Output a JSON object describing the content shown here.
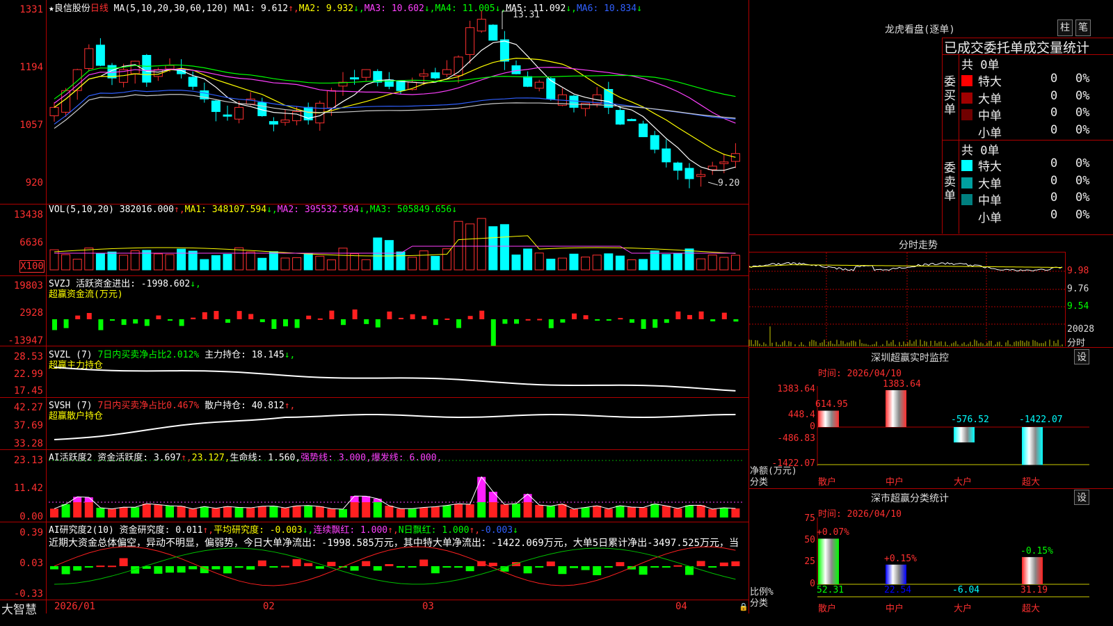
{
  "left_axis": {
    "price": [
      "1331",
      "1194",
      "1057",
      "920"
    ],
    "vol": [
      "13438",
      "6636",
      "X100"
    ],
    "svzj": [
      "19803",
      "2928",
      "-13947"
    ],
    "svzl": [
      "28.53",
      "22.99",
      "17.45"
    ],
    "svsh": [
      "42.27",
      "37.69",
      "33.28"
    ],
    "ai2": [
      "23.13",
      "11.42",
      "0.00"
    ],
    "aiyj": [
      "0.39",
      "0.03",
      "-0.33"
    ]
  },
  "main_header": [
    {
      "t": "★良信股份",
      "c": "#ffffff"
    },
    {
      "t": "日线",
      "c": "#ff3030"
    },
    {
      "t": " MA(5,10,20,30,60,120) MA1: 9.612",
      "c": "#ffffff"
    },
    {
      "t": "↑,",
      "c": "#ff3030"
    },
    {
      "t": "MA2: 9.932",
      "c": "#ffff00"
    },
    {
      "t": "↓,",
      "c": "#00ff00"
    },
    {
      "t": "MA3: 10.602",
      "c": "#ff40ff"
    },
    {
      "t": "↓,",
      "c": "#00ff00"
    },
    {
      "t": "MA4: 11.005",
      "c": "#00ff00"
    },
    {
      "t": "↓,",
      "c": "#00ff00"
    },
    {
      "t": "MA5: 11.092",
      "c": "#ffffff"
    },
    {
      "t": "↓,",
      "c": "#00ff00"
    },
    {
      "t": "MA6: 10.834",
      "c": "#3060ff"
    },
    {
      "t": "↓",
      "c": "#00ff00"
    }
  ],
  "price_marks": {
    "high": "13.31",
    "low": "9.20"
  },
  "vol_header": [
    {
      "t": "VOL(5,10,20) 382016.000",
      "c": "#ffffff"
    },
    {
      "t": "↑,",
      "c": "#ff3030"
    },
    {
      "t": "MA1: 348107.594",
      "c": "#ffff00"
    },
    {
      "t": "↓,",
      "c": "#00ff00"
    },
    {
      "t": "MA2: 395532.594",
      "c": "#ff40ff"
    },
    {
      "t": "↓,",
      "c": "#00ff00"
    },
    {
      "t": "MA3: 505849.656",
      "c": "#00ff00"
    },
    {
      "t": "↓",
      "c": "#00ff00"
    }
  ],
  "svzj_header": [
    {
      "t": "SVZJ  活跃资金进出: -1998.602",
      "c": "#ffffff"
    },
    {
      "t": "↓,",
      "c": "#00ff00"
    }
  ],
  "svzj_sub": "超赢资金流(万元)",
  "svzl_header": [
    {
      "t": "SVZL (7) ",
      "c": "#ffffff"
    },
    {
      "t": "7日内买卖净占比2.012%",
      "c": "#00ff00"
    },
    {
      "t": " 主力持仓: 18.145",
      "c": "#ffffff"
    },
    {
      "t": "↓,",
      "c": "#00ff00"
    }
  ],
  "svzl_sub": "超赢主力持仓",
  "svsh_header": [
    {
      "t": "SVSH (7) ",
      "c": "#ffffff"
    },
    {
      "t": "7日内买卖净占比0.467%",
      "c": "#ff3030"
    },
    {
      "t": " 散户持仓: 40.812",
      "c": "#ffffff"
    },
    {
      "t": "↑,",
      "c": "#ff3030"
    }
  ],
  "svsh_sub": "超赢散户持仓",
  "ai2_header": [
    {
      "t": "AI活跃度2 资金活跃度: 3.697",
      "c": "#ffffff"
    },
    {
      "t": "↑,",
      "c": "#ff3030"
    },
    {
      "t": "23.127,",
      "c": "#ffff00"
    },
    {
      "t": "生命线: 1.560,",
      "c": "#ffffff"
    },
    {
      "t": "强势线: 3.000,",
      "c": "#ff40ff"
    },
    {
      "t": "爆发线: 6.000,",
      "c": "#ff40ff"
    }
  ],
  "aiyj_header": [
    {
      "t": "AI研究度2(10) 资金研究度: 0.011",
      "c": "#ffffff"
    },
    {
      "t": "↑,",
      "c": "#ff3030"
    },
    {
      "t": "平均研究度: -0.003",
      "c": "#ffff00"
    },
    {
      "t": "↓,",
      "c": "#00ff00"
    },
    {
      "t": "连续飘红: 1.000",
      "c": "#ff40ff"
    },
    {
      "t": "↑,",
      "c": "#ff3030"
    },
    {
      "t": "N日飘红: 1.000",
      "c": "#00ff00"
    },
    {
      "t": "↑,",
      "c": "#ff3030"
    },
    {
      "t": "-0.003",
      "c": "#3060ff"
    },
    {
      "t": "↓",
      "c": "#00ff00"
    }
  ],
  "aiyj_note": "近期大资金总体偏空，异动不明显，偏弱势，今日大单净流出：-1998.585万元，其中特大单净流出：-1422.069万元，大单5日累计净出-3497.525万元，当",
  "bottom_bar": {
    "logo": "大智慧",
    "dates": [
      "2026/01",
      "02",
      "03",
      "04"
    ]
  },
  "right": {
    "lhb_title": "龙虎看盘(逐单)",
    "btn_zhu": "柱",
    "btn_bi": "笔",
    "stat_title": "已成交委托单成交量统计",
    "buy_label": "委买单",
    "sell_label": "委卖单",
    "buy_total": "共 0单",
    "sell_total": "共 0单",
    "buy_rows": [
      {
        "name": "特大",
        "n": "0",
        "p": "0%",
        "color": "#ff0000"
      },
      {
        "name": "大单",
        "n": "0",
        "p": "0%",
        "color": "#a00000"
      },
      {
        "name": "中单",
        "n": "0",
        "p": "0%",
        "color": "#700000"
      },
      {
        "name": "小单",
        "n": "0",
        "p": "0%",
        "color": "#000000"
      }
    ],
    "sell_rows": [
      {
        "name": "特大",
        "n": "0",
        "p": "0%",
        "color": "#00ffff"
      },
      {
        "name": "大单",
        "n": "0",
        "p": "0%",
        "color": "#00a0a0"
      },
      {
        "name": "中单",
        "n": "0",
        "p": "0%",
        "color": "#008080"
      },
      {
        "name": "小单",
        "n": "0",
        "p": "0%",
        "color": "#000000"
      }
    ],
    "fenshi_title": "分时走势",
    "fenshi_axis": [
      "9.98",
      "9.76",
      "9.54",
      "20028",
      "分时"
    ],
    "szcy_title": "深圳超赢实时监控",
    "szcy_time": "时间: 2026/04/10",
    "szcy_axis": [
      "1383.64",
      "448.4",
      "0",
      "-486.83",
      "-1422.07"
    ],
    "szcy_ylabel": "净额(万元)",
    "szcy_xlabel": "分类",
    "szcy_cats": [
      "散户",
      "中户",
      "大户",
      "超大"
    ],
    "szcy_values": [
      "614.95",
      "1383.64",
      "-576.52",
      "-1422.07"
    ],
    "szcy_btn": "设",
    "fl_title": "深市超赢分类统计",
    "fl_time": "时间: 2026/04/10",
    "fl_axis": [
      "75",
      "50",
      "25",
      "0"
    ],
    "fl_ylabel": "比例%",
    "fl_xlabel": "分类",
    "fl_cats": [
      "散户",
      "中户",
      "大户",
      "超大"
    ],
    "fl_top": [
      "+0.07%",
      "+0.15%",
      "",
      "-0.15%"
    ],
    "fl_values": [
      "52.31",
      "22.54",
      "-6.04",
      "31.19"
    ],
    "fl_btn": "设"
  },
  "chart_data": [
    {
      "type": "bar",
      "title": "深圳超赢实时监控",
      "categories": [
        "散户",
        "中户",
        "大户",
        "超大"
      ],
      "values": [
        614.95,
        1383.64,
        -576.52,
        -1422.07
      ],
      "ylabel": "净额(万元)",
      "ylim": [
        -1422.07,
        1383.64
      ]
    },
    {
      "type": "bar",
      "title": "深市超赢分类统计",
      "categories": [
        "散户",
        "中户",
        "大户",
        "超大"
      ],
      "values": [
        52.31,
        22.54,
        -6.04,
        31.19
      ],
      "ylabel": "比例%",
      "ylim": [
        0,
        75
      ]
    }
  ],
  "colors": {
    "up": "#ff3030",
    "down": "#00ffff",
    "grid": "#b00000",
    "green": "#00ff00",
    "magenta": "#ff40ff",
    "yellow": "#ffff00"
  }
}
